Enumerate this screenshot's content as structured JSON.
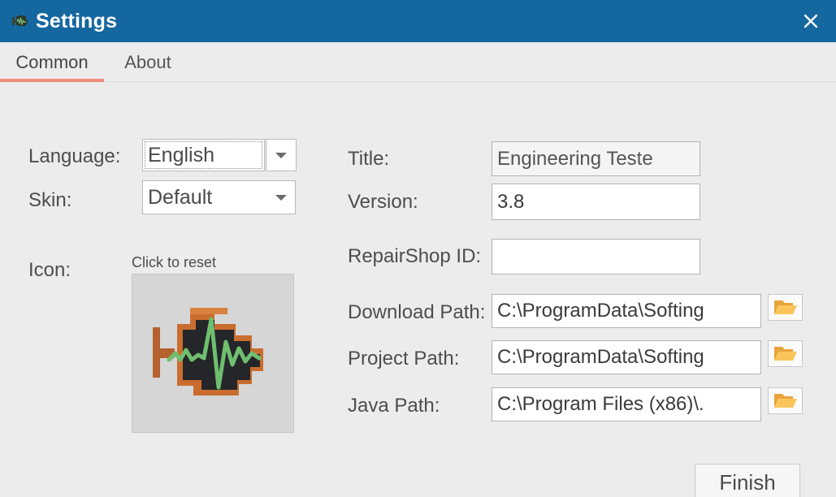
{
  "window": {
    "title": "Settings",
    "app_icon": "engine-icon",
    "close_label": "×",
    "titlebar_color": "#15679f",
    "background_color": "#ececec"
  },
  "tabs": {
    "items": [
      {
        "label": "Common",
        "active": true
      },
      {
        "label": "About",
        "active": false
      }
    ],
    "active_underline_color": "#ef8c7b"
  },
  "left_panel": {
    "language": {
      "label": "Language:",
      "value": "English",
      "arrow_icon": "chevron-down-icon"
    },
    "skin": {
      "label": "Skin:",
      "value": "Default",
      "arrow_icon": "chevron-down-icon"
    },
    "icon": {
      "label": "Icon:",
      "hint": "Click to reset",
      "preview_icon": "check-engine-icon"
    }
  },
  "right_panel": {
    "title_field": {
      "label": "Title:",
      "value": "Engineering Teste",
      "readonly": true
    },
    "version_field": {
      "label": "Version:",
      "value": "3.8"
    },
    "repairshop_field": {
      "label": "RepairShop ID:",
      "value": "",
      "placeholder": ""
    },
    "download_path": {
      "label": "Download Path:",
      "value": "C:\\ProgramData\\Softing",
      "browse_icon": "folder-open-icon"
    },
    "project_path": {
      "label": "Project Path:",
      "value": "C:\\ProgramData\\Softing",
      "browse_icon": "folder-open-icon"
    },
    "java_path": {
      "label": "Java Path:",
      "value": "C:\\Program Files (x86)\\.",
      "browse_icon": "folder-open-icon"
    }
  },
  "footer": {
    "finish_label": "Finish"
  }
}
